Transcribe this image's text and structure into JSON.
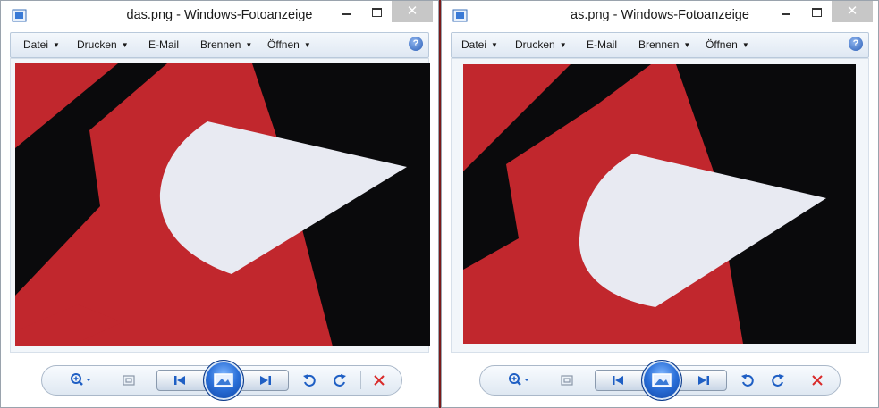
{
  "windows": [
    {
      "title": "das.png - Windows-Fotoanzeige",
      "menu": [
        "Datei",
        "Drucken",
        "E-Mail",
        "Brennen",
        "Öffnen"
      ],
      "help": "?",
      "close_glyph": "✕"
    },
    {
      "title": "as.png - Windows-Fotoanzeige",
      "menu": [
        "Datei",
        "Drucken",
        "E-Mail",
        "Brennen",
        "Öffnen"
      ],
      "help": "?",
      "close_glyph": "✕"
    }
  ],
  "toolbar_icons": [
    "zoom-icon",
    "fit-window-icon",
    "previous-icon",
    "slideshow-icon",
    "next-icon",
    "rotate-left-icon",
    "rotate-right-icon",
    "delete-icon"
  ],
  "colors": {
    "image_red": "#c1272d",
    "image_black": "#0a0a0c",
    "image_white": "#e8eaf2",
    "accent_blue": "#1f5fc4",
    "delete_red": "#d92a2a"
  }
}
